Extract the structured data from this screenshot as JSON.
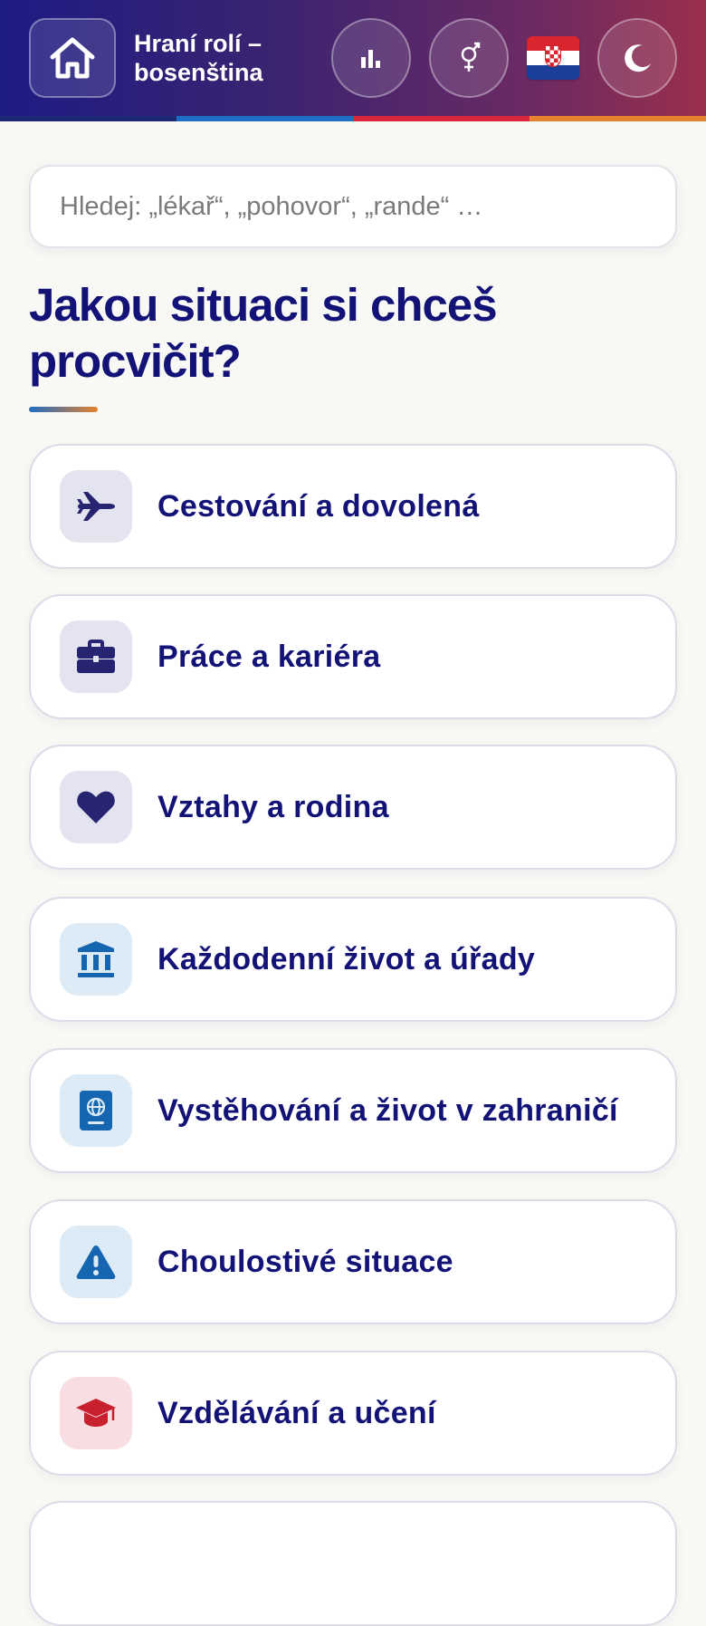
{
  "header": {
    "title": "Hraní rolí – bosenština",
    "flag_emoji_name": "croatia-flag",
    "stripe_colors": [
      "#1d2a73",
      "#1f6cc4",
      "#d7263d",
      "#e5822d"
    ],
    "buttons": {
      "home": "home-icon",
      "stats": "bar-chart-icon",
      "gender": "gender-icon",
      "theme": "moon-icon"
    }
  },
  "search": {
    "placeholder": "Hledej: „lékař“, „pohovor“, „rande“ …"
  },
  "main": {
    "heading": "Jakou situaci si chceš procvičit?",
    "categories": [
      {
        "label": "Cestování a dovolená",
        "icon": "airplane-icon",
        "tint": "purple"
      },
      {
        "label": "Práce a kariéra",
        "icon": "briefcase-icon",
        "tint": "purple"
      },
      {
        "label": "Vztahy a rodina",
        "icon": "heart-icon",
        "tint": "purple"
      },
      {
        "label": "Každodenní život a úřady",
        "icon": "bank-icon",
        "tint": "blue"
      },
      {
        "label": "Vystěhování a život v zahraničí",
        "icon": "passport-icon",
        "tint": "blue"
      },
      {
        "label": "Choulostivé situace",
        "icon": "warning-icon",
        "tint": "blue"
      },
      {
        "label": "Vzdělávání a učení",
        "icon": "graduation-cap-icon",
        "tint": "red"
      }
    ]
  },
  "colors": {
    "accent_navy": "#131377",
    "header_start": "#1d1c84",
    "header_end": "#9a2f4c"
  }
}
